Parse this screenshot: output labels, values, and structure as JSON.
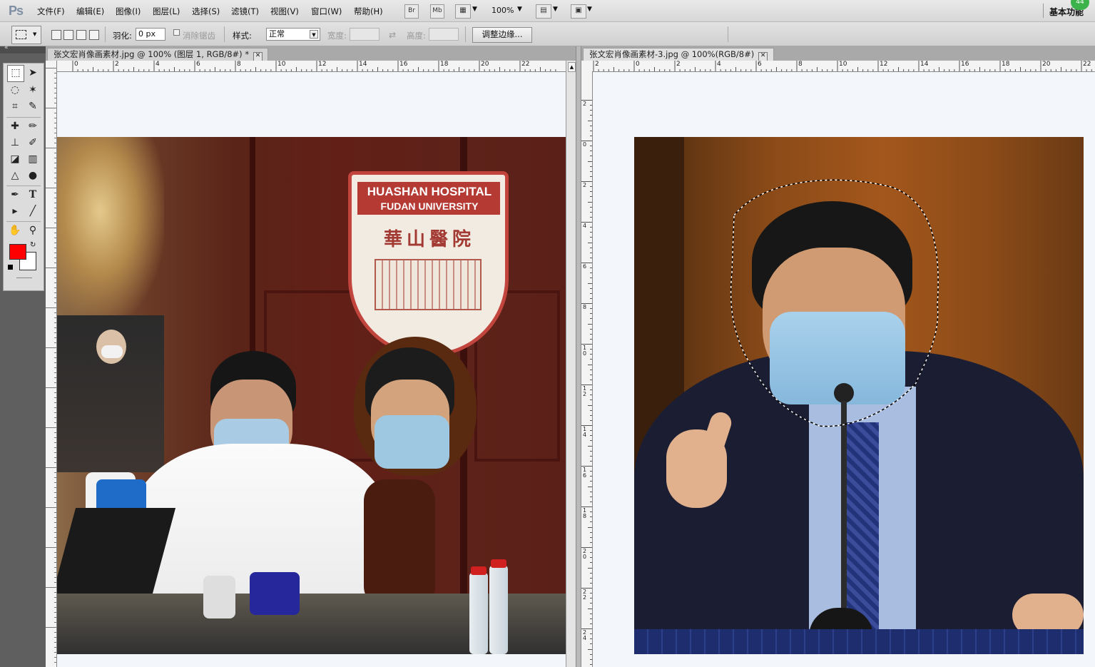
{
  "app": {
    "logo": "Ps",
    "workspace": "基本功能",
    "badge": "44"
  },
  "menus": [
    "文件(F)",
    "编辑(E)",
    "图像(I)",
    "图层(L)",
    "选择(S)",
    "滤镜(T)",
    "视图(V)",
    "窗口(W)",
    "帮助(H)"
  ],
  "menubar_buttons": {
    "bridge": "Br",
    "mini_bridge": "Mb",
    "zoom": "100%"
  },
  "options": {
    "feather_label": "羽化:",
    "feather_value": "0 px",
    "antialias_label": "消除锯齿",
    "style_label": "样式:",
    "style_value": "正常",
    "width_label": "宽度:",
    "height_label": "高度:",
    "refine_button": "调整边缘..."
  },
  "documents": [
    {
      "title": "张文宏肖像画素材.jpg @ 100% (图层 1, RGB/8#) *",
      "ruler_h": [
        "0",
        "2",
        "4",
        "6",
        "8",
        "10",
        "12",
        "14",
        "16",
        "18",
        "20",
        "22"
      ]
    },
    {
      "title": "张文宏肖像画素材-3.jpg @ 100%(RGB/8#)",
      "ruler_h": [
        "2",
        "0",
        "2",
        "4",
        "6",
        "8",
        "10",
        "12",
        "14",
        "16",
        "18",
        "20",
        "22"
      ],
      "ruler_v": [
        "2",
        "0",
        "2",
        "4",
        "6",
        "8",
        "10",
        "12",
        "14",
        "16",
        "18",
        "20",
        "22",
        "24"
      ]
    }
  ],
  "photo1": {
    "banner_line1": "HUASHAN HOSPITAL",
    "banner_line2": "FUDAN UNIVERSITY",
    "banner_cn": "華山醫院"
  },
  "colors": {
    "foreground": "#ff0000",
    "background": "#ffffff"
  }
}
